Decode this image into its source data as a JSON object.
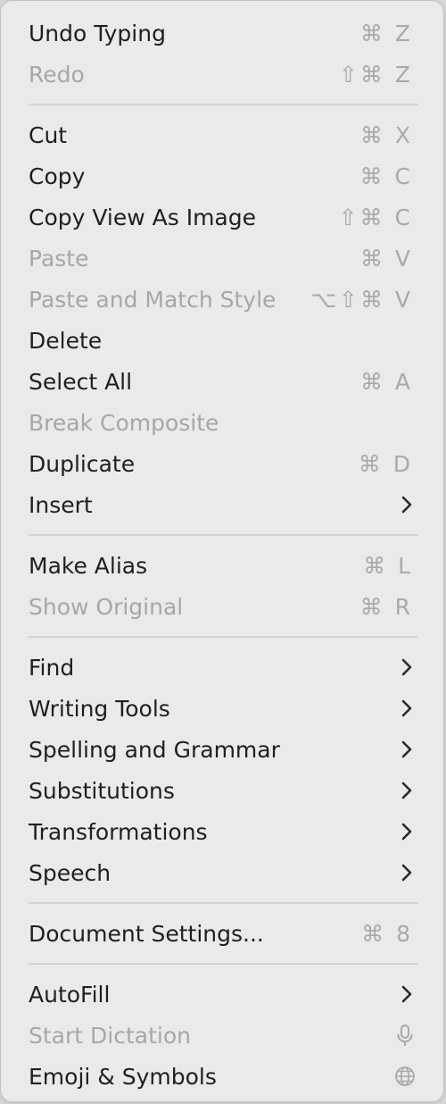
{
  "menu": {
    "items": [
      {
        "label": "Undo Typing",
        "shortcut": "⌘ Z",
        "disabled": false
      },
      {
        "label": "Redo",
        "shortcut": "⇧⌘ Z",
        "disabled": true
      },
      {
        "label": "Cut",
        "shortcut": "⌘ X",
        "disabled": false
      },
      {
        "label": "Copy",
        "shortcut": "⌘ C",
        "disabled": false
      },
      {
        "label": "Copy View As Image",
        "shortcut": "⇧⌘ C",
        "disabled": false
      },
      {
        "label": "Paste",
        "shortcut": "⌘ V",
        "disabled": true
      },
      {
        "label": "Paste and Match Style",
        "shortcut": "⌥⇧⌘ V",
        "disabled": true
      },
      {
        "label": "Delete",
        "disabled": false
      },
      {
        "label": "Select All",
        "shortcut": "⌘ A",
        "disabled": false
      },
      {
        "label": "Break Composite",
        "disabled": true
      },
      {
        "label": "Duplicate",
        "shortcut": "⌘ D",
        "disabled": false
      },
      {
        "label": "Insert",
        "submenu": true,
        "disabled": false
      },
      {
        "label": "Make Alias",
        "shortcut": "⌘ L",
        "disabled": false
      },
      {
        "label": "Show Original",
        "shortcut": "⌘ R",
        "disabled": true
      },
      {
        "label": "Find",
        "submenu": true,
        "disabled": false
      },
      {
        "label": "Writing Tools",
        "submenu": true,
        "disabled": false
      },
      {
        "label": "Spelling and Grammar",
        "submenu": true,
        "disabled": false
      },
      {
        "label": "Substitutions",
        "submenu": true,
        "disabled": false
      },
      {
        "label": "Transformations",
        "submenu": true,
        "disabled": false
      },
      {
        "label": "Speech",
        "submenu": true,
        "disabled": false
      },
      {
        "label": "Document Settings...",
        "shortcut": "⌘ 8",
        "disabled": false
      },
      {
        "label": "AutoFill",
        "submenu": true,
        "disabled": false
      },
      {
        "label": "Start Dictation",
        "icon": "microphone-icon",
        "disabled": true
      },
      {
        "label": "Emoji & Symbols",
        "icon": "globe-icon",
        "disabled": false
      }
    ]
  },
  "colors": {
    "menu_background": "#eaeaea",
    "enabled_text": "#1f1f1f",
    "disabled_text": "#a7a7a7",
    "shortcut_text": "#a9a9a9",
    "separator": "#d2d2d2"
  }
}
